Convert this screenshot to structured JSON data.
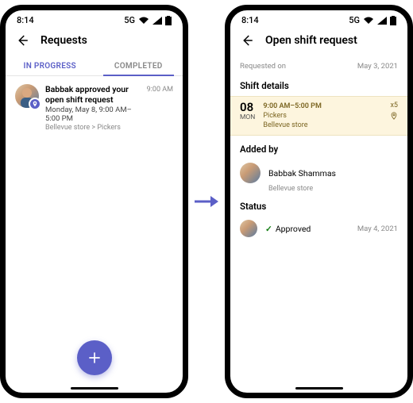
{
  "statusbar": {
    "time": "8:14",
    "net": "5G"
  },
  "left": {
    "title": "Requests",
    "tabs": {
      "inprogress": "IN PROGRESS",
      "completed": "COMPLETED"
    },
    "item": {
      "title": "Babbak approved your open shift request",
      "sub": "Monday, May 8, 9:00 AM–5:00 PM",
      "meta": "Bellevue store > Pickers",
      "time": "9:00 AM"
    }
  },
  "right": {
    "title": "Open shift request",
    "requestedOn": {
      "label": "Requested on",
      "date": "May 3, 2021"
    },
    "shiftDetails": {
      "header": "Shift details",
      "day": "08",
      "dow": "MON",
      "time": "9:00 AM–5:00 PM",
      "group": "Pickers",
      "location": "Bellevue store",
      "count": "x5"
    },
    "addedBy": {
      "header": "Added by",
      "name": "Babbak Shammas",
      "meta": "Bellevue store"
    },
    "status": {
      "header": "Status",
      "value": "Approved",
      "date": "May 4, 2021"
    }
  }
}
